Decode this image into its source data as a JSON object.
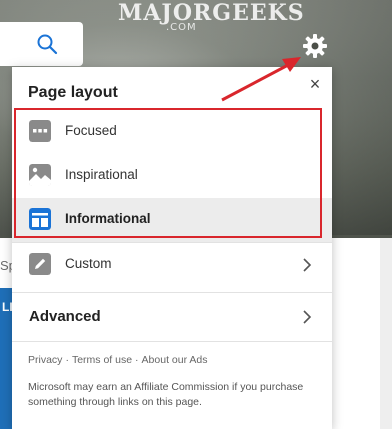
{
  "watermark": {
    "brand": "MAJORGEEKS",
    "sub": ".COM"
  },
  "panel": {
    "title": "Page layout",
    "close_glyph": "×",
    "options": [
      {
        "label": "Focused",
        "icon": "focused-layout-icon"
      },
      {
        "label": "Inspirational",
        "icon": "inspirational-layout-icon"
      },
      {
        "label": "Informational",
        "icon": "informational-layout-icon",
        "selected": true
      },
      {
        "label": "Custom",
        "icon": "pencil-icon"
      }
    ],
    "advanced_label": "Advanced",
    "footer_links": [
      "Privacy",
      "Terms of use",
      "About our Ads"
    ],
    "footer_sep": "·",
    "footer_note": "Microsoft may earn an Affiliate Commission if you purchase something through links on this page."
  },
  "background": {
    "sp_fragment": "Sp",
    "lv_fragment": "LIV"
  },
  "colors": {
    "highlight": "#d9262c",
    "selected_icon": "#1a73d6",
    "icon_grey": "#8a8a8a",
    "search_icon": "#1a73d6"
  }
}
